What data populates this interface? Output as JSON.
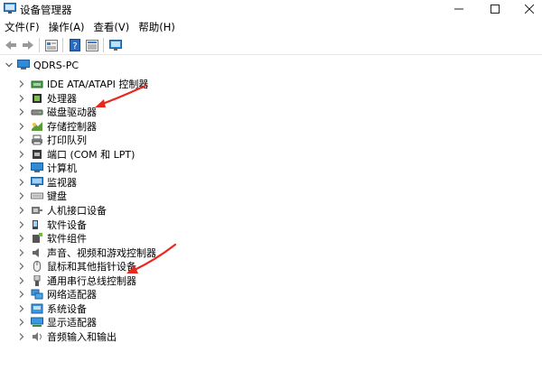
{
  "window": {
    "title": "设备管理器",
    "controls": {
      "minimize": "—",
      "maximize": "☐",
      "close": "✕"
    }
  },
  "menu": [
    {
      "label": "文件(F)"
    },
    {
      "label": "操作(A)"
    },
    {
      "label": "查看(V)"
    },
    {
      "label": "帮助(H)"
    }
  ],
  "toolbar": [
    "back-icon",
    "forward-icon",
    "properties-icon",
    "help-icon",
    "view-icon",
    "monitor-icon"
  ],
  "tree": {
    "root": "QDRS-PC",
    "nodes": [
      {
        "label": "IDE ATA/ATAPI 控制器",
        "icon": "ide-controller-icon"
      },
      {
        "label": "处理器",
        "icon": "processor-icon"
      },
      {
        "label": "磁盘驱动器",
        "icon": "disk-drive-icon"
      },
      {
        "label": "存储控制器",
        "icon": "storage-controller-icon"
      },
      {
        "label": "打印队列",
        "icon": "print-queue-icon"
      },
      {
        "label": "端口 (COM 和 LPT)",
        "icon": "port-icon"
      },
      {
        "label": "计算机",
        "icon": "computer-icon"
      },
      {
        "label": "监视器",
        "icon": "monitor-icon"
      },
      {
        "label": "键盘",
        "icon": "keyboard-icon"
      },
      {
        "label": "人机接口设备",
        "icon": "hid-icon"
      },
      {
        "label": "软件设备",
        "icon": "software-device-icon"
      },
      {
        "label": "软件组件",
        "icon": "software-component-icon"
      },
      {
        "label": "声音、视频和游戏控制器",
        "icon": "sound-icon"
      },
      {
        "label": "鼠标和其他指针设备",
        "icon": "mouse-icon"
      },
      {
        "label": "通用串行总线控制器",
        "icon": "usb-icon"
      },
      {
        "label": "网络适配器",
        "icon": "network-adapter-icon"
      },
      {
        "label": "系统设备",
        "icon": "system-device-icon"
      },
      {
        "label": "显示适配器",
        "icon": "display-adapter-icon"
      },
      {
        "label": "音频输入和输出",
        "icon": "audio-io-icon"
      }
    ]
  },
  "annotations": {
    "arrow_color": "#e8281e"
  }
}
